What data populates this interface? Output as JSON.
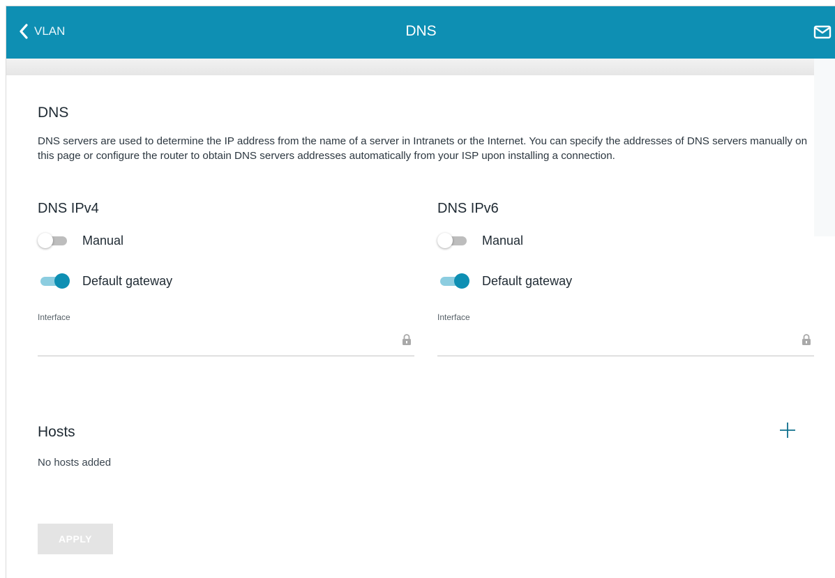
{
  "header": {
    "back_label": "VLAN",
    "title": "DNS",
    "mail_icon": "envelope-icon"
  },
  "colors": {
    "accent": "#0e8fb3",
    "toggle_on_track": "#8ccde0",
    "toggle_off_track": "#bdbdbd",
    "apply_disabled": "#e4e4e4"
  },
  "dns_section": {
    "title": "DNS",
    "description": "DNS servers are used to determine the IP address from the name of a server in Intranets or the Internet. You can specify the addresses of DNS servers manually on this page or configure the router to obtain DNS servers addresses automatically from your ISP upon installing a connection."
  },
  "ipv4": {
    "title": "DNS IPv4",
    "manual": {
      "label": "Manual",
      "on": false
    },
    "default_gateway": {
      "label": "Default gateway",
      "on": true
    },
    "interface": {
      "label": "Interface",
      "value": "",
      "locked": true
    }
  },
  "ipv6": {
    "title": "DNS IPv6",
    "manual": {
      "label": "Manual",
      "on": false
    },
    "default_gateway": {
      "label": "Default gateway",
      "on": true
    },
    "interface": {
      "label": "Interface",
      "value": "",
      "locked": true
    }
  },
  "hosts": {
    "title": "Hosts",
    "empty_text": "No hosts added",
    "add_icon": "plus-icon"
  },
  "apply": {
    "label": "APPLY",
    "disabled": true
  }
}
